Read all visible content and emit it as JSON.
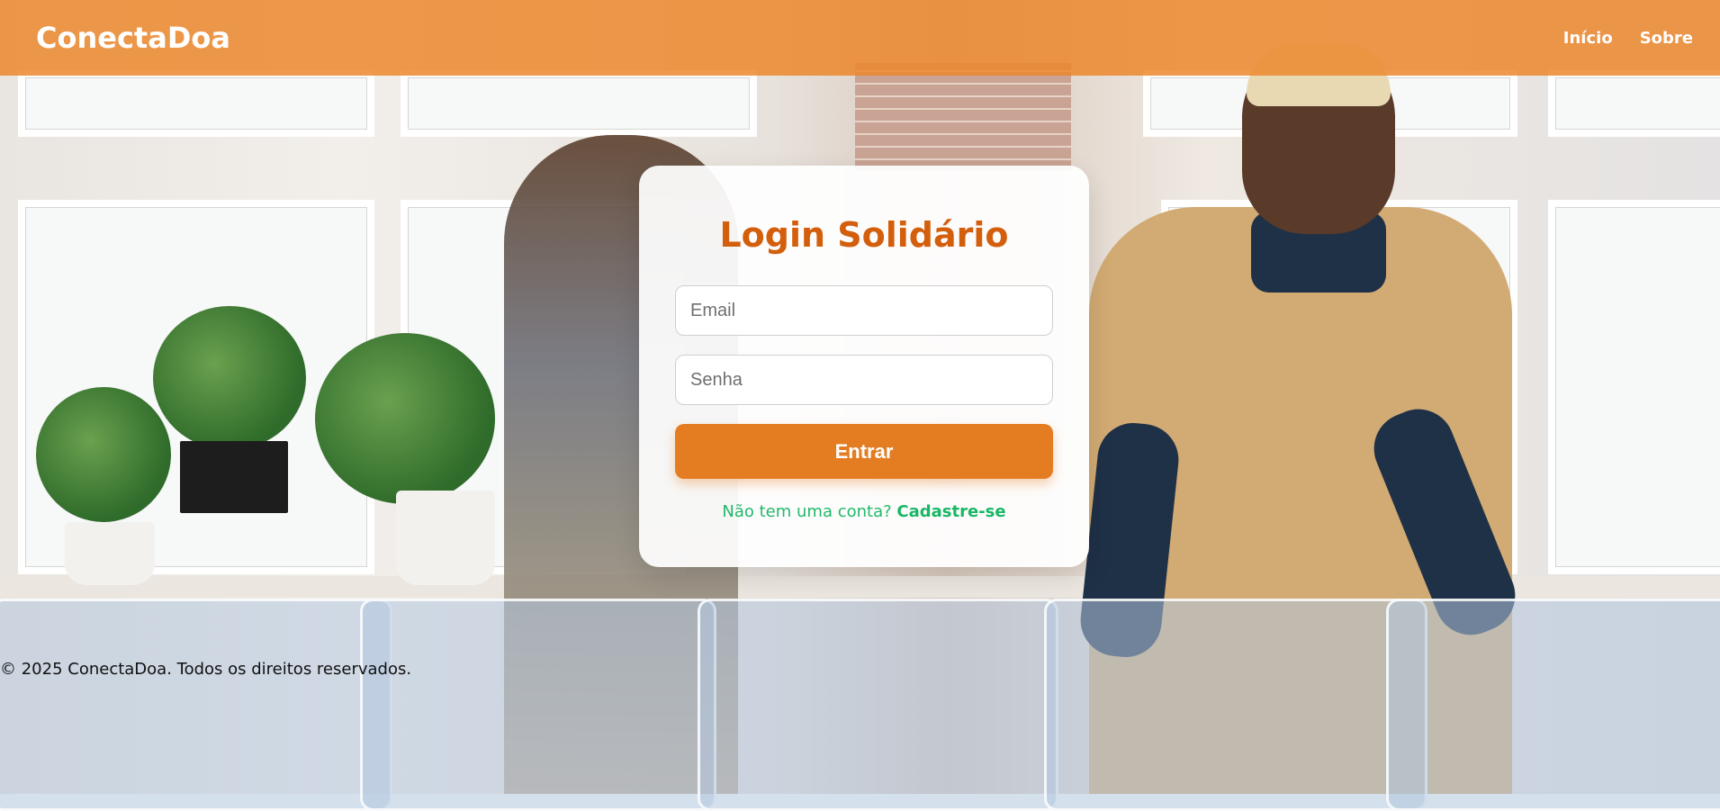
{
  "header": {
    "brand": "ConectaDoa",
    "nav": [
      {
        "label": "Início"
      },
      {
        "label": "Sobre"
      }
    ]
  },
  "login": {
    "title": "Login Solidário",
    "email_placeholder": "Email",
    "password_placeholder": "Senha",
    "submit_label": "Entrar",
    "signup_prompt": "Não tem uma conta?",
    "signup_link": "Cadastre-se"
  },
  "footer": {
    "text": "© 2025 ConectaDoa. Todos os direitos reservados."
  },
  "colors": {
    "header_bg": "#eb872d",
    "title": "#d35f0d",
    "button": "#e47d21",
    "signup": "#19b766"
  }
}
